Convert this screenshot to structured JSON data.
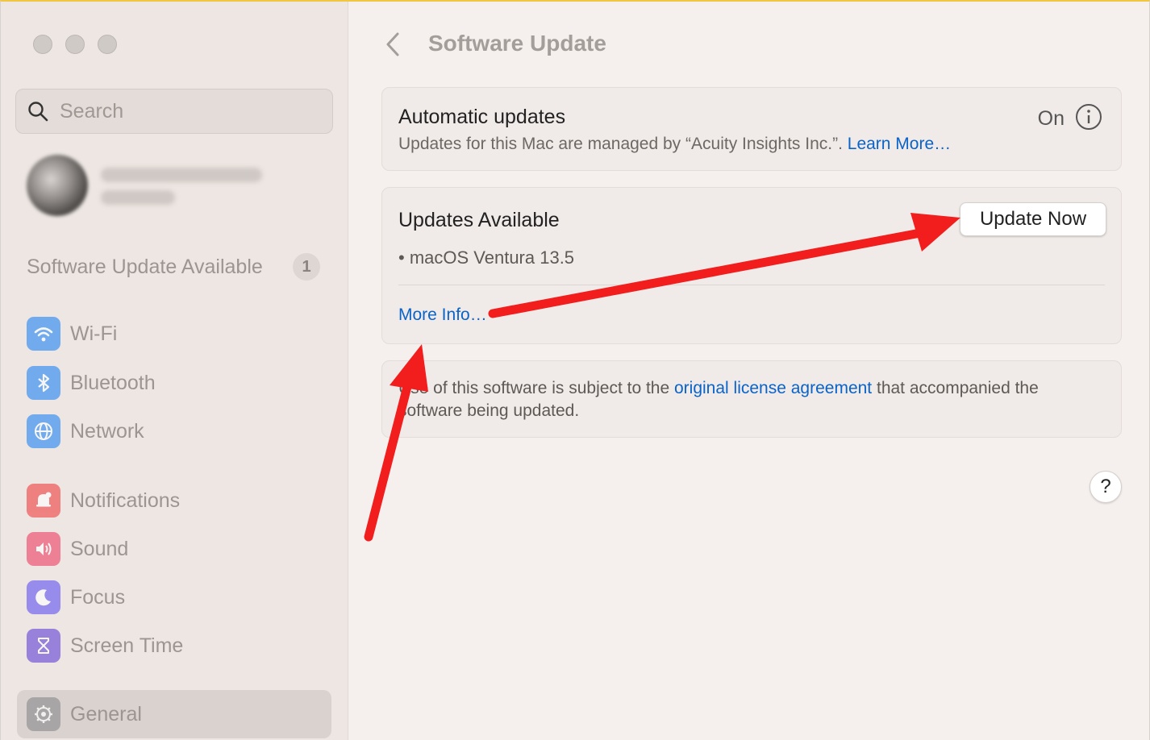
{
  "sidebar": {
    "search_placeholder": "Search",
    "software_update_label": "Software Update Available",
    "software_update_badge": "1",
    "items": [
      {
        "label": "Wi-Fi",
        "icon": "wifi-icon",
        "color": "#2f8cf5"
      },
      {
        "label": "Bluetooth",
        "icon": "bluetooth-icon",
        "color": "#2f8cf5"
      },
      {
        "label": "Network",
        "icon": "globe-icon",
        "color": "#2f8cf5"
      },
      {
        "label": "Notifications",
        "icon": "bell-icon",
        "color": "#f04b4b"
      },
      {
        "label": "Sound",
        "icon": "speaker-icon",
        "color": "#f04b6e"
      },
      {
        "label": "Focus",
        "icon": "moon-icon",
        "color": "#6a5cf0"
      },
      {
        "label": "Screen Time",
        "icon": "hourglass-icon",
        "color": "#6a4cd8"
      },
      {
        "label": "General",
        "icon": "gear-icon",
        "color": "#8e8e93"
      }
    ],
    "selected_item": "General"
  },
  "main": {
    "title": "Software Update",
    "automatic": {
      "title": "Automatic updates",
      "status": "On",
      "managed_text": "Updates for this Mac are managed by “Acuity Insights Inc.”.",
      "learn_more": "Learn More…"
    },
    "available": {
      "title": "Updates Available",
      "button": "Update Now",
      "item": "• macOS Ventura 13.5",
      "more_info": "More Info…"
    },
    "license": {
      "prefix": "Use of this software is subject to the",
      "link": "original license agreement",
      "suffix": "that accompanied the software being updated."
    },
    "help": "?"
  },
  "colors": {
    "accent_link": "#0a63c9",
    "annotation_arrow": "#f21d1d",
    "window_top_border": "#f0c642"
  }
}
